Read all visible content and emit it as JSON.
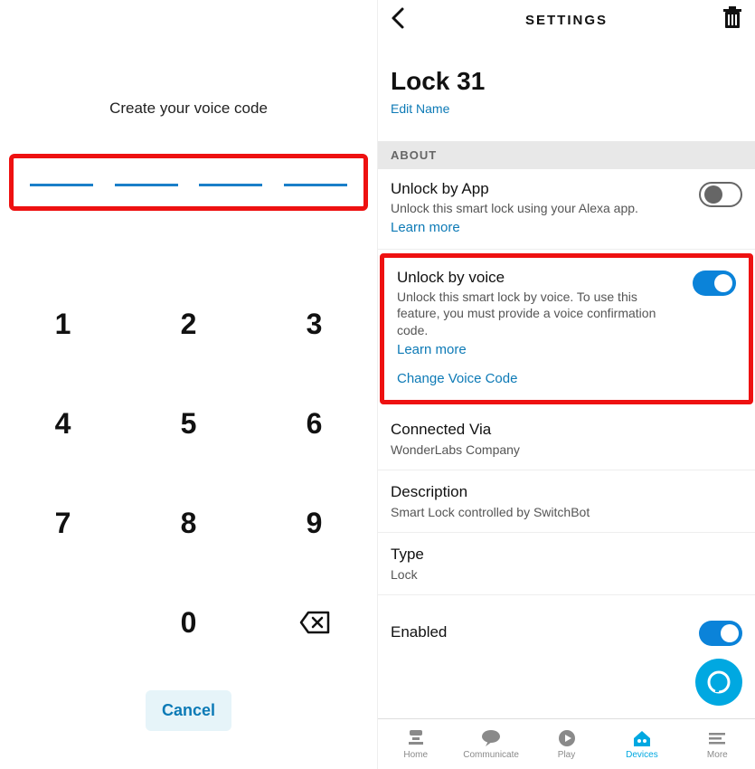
{
  "left": {
    "title": "Create your voice code",
    "keys": [
      "1",
      "2",
      "3",
      "4",
      "5",
      "6",
      "7",
      "8",
      "9",
      "",
      "0",
      "⌫"
    ],
    "cancel": "Cancel"
  },
  "right": {
    "header": {
      "title": "SETTINGS"
    },
    "device": {
      "name": "Lock 31",
      "edit": "Edit Name"
    },
    "section_about": "ABOUT",
    "unlock_app": {
      "title": "Unlock by App",
      "desc": "Unlock this smart lock using your Alexa app.",
      "learn": "Learn more",
      "on": false
    },
    "unlock_voice": {
      "title": "Unlock by voice",
      "desc": "Unlock this smart lock by voice. To use this feature, you must provide a voice confirmation code.",
      "learn": "Learn more",
      "change": "Change Voice Code",
      "on": true
    },
    "connected_via": {
      "label": "Connected Via",
      "value": "WonderLabs Company"
    },
    "description": {
      "label": "Description",
      "value": "Smart Lock controlled by SwitchBot"
    },
    "type": {
      "label": "Type",
      "value": "Lock"
    },
    "enabled": {
      "label": "Enabled",
      "on": true
    },
    "tabs": {
      "home": "Home",
      "communicate": "Communicate",
      "play": "Play",
      "devices": "Devices",
      "more": "More",
      "active": "devices"
    }
  }
}
